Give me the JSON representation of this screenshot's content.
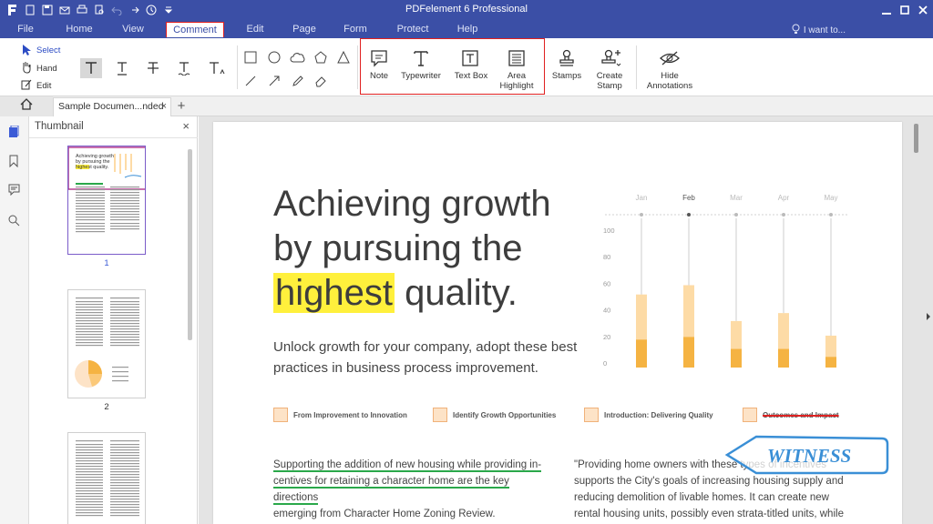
{
  "window": {
    "title": "PDFelement 6 Professional"
  },
  "menu": {
    "items": [
      "File",
      "Home",
      "View",
      "Comment",
      "Edit",
      "Page",
      "Form",
      "Protect",
      "Help"
    ],
    "active": "Comment",
    "search_hint": "I want to..."
  },
  "ribbon": {
    "select": "Select",
    "hand": "Hand",
    "edit": "Edit",
    "note": "Note",
    "typewriter": "Typewriter",
    "textbox": "Text Box",
    "area_highlight": "Area Highlight",
    "stamps": "Stamps",
    "create_stamp": "Create Stamp",
    "hide_annotations": "Hide Annotations"
  },
  "tabs": {
    "doc_title": "Sample Documen...nded",
    "close_glyph": "×",
    "add_glyph": "+"
  },
  "thumbnail_panel": {
    "title": "Thumbnail",
    "close_glyph": "×",
    "pages": [
      "1",
      "2"
    ]
  },
  "document": {
    "headline_1": "Achieving growth",
    "headline_2": "by pursuing the",
    "headline_3_highlight": "highest",
    "headline_3_rest": " quality.",
    "subline": "Unlock growth for your company, adopt these best practices in business process improvement.",
    "features": [
      "From Improvement to Innovation",
      "Identify Growth Opportunities",
      "Introduction: Delivering Quality",
      "Outcomes and Impact"
    ],
    "para_left_underlined_1": "Supporting the addition of new housing while providing in-",
    "para_left_underlined_2": "centives for retaining a character home are the key directions",
    "para_left_rest": "emerging from Character Home Zoning Review.",
    "para_right": "\"Providing home owners with these types of incentives supports the City's goals of increasing housing supply and reducing demolition of livable homes.  It can create new rental housing units, possibly even strata-titled units, while",
    "stamp_text": "WITNESS"
  },
  "chart_data": {
    "type": "bar",
    "categories": [
      "Jan",
      "Feb",
      "Mar",
      "Apr",
      "May"
    ],
    "series": [
      {
        "values": [
          55,
          62,
          35,
          41,
          24
        ]
      },
      {
        "values": [
          21,
          23,
          14,
          14,
          8
        ]
      }
    ],
    "yticks": [
      "100",
      "80",
      "60",
      "40",
      "20",
      "0"
    ],
    "ylim": [
      0,
      100
    ],
    "colors": {
      "light": "#fddba6",
      "dark": "#f5b342"
    }
  },
  "colors": {
    "titlebar": "#3b4fa6",
    "highlight": "#fff03c",
    "annotation_box": "#e02020",
    "stamp": "#3a8fd6",
    "underline": "#2aa84a"
  }
}
